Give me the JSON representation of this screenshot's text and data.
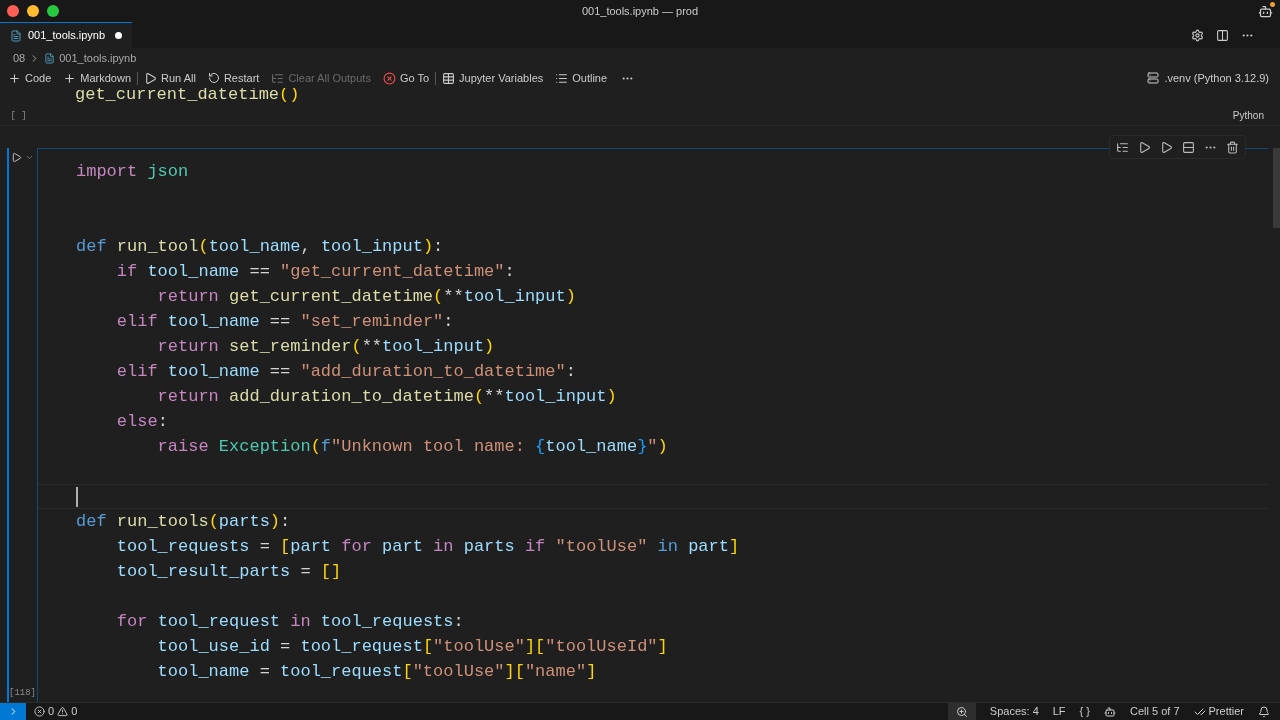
{
  "window": {
    "title": "001_tools.ipynb — prod"
  },
  "tabs": [
    {
      "label": "001_tools.ipynb",
      "selected": true,
      "modified": true
    }
  ],
  "breadcrumb": [
    "08",
    "001_tools.ipynb"
  ],
  "toolbar": {
    "groups": [
      [
        {
          "label": "Code",
          "kind": "add",
          "disabled": false
        },
        {
          "label": "Markdown",
          "kind": "add",
          "disabled": false
        }
      ],
      [
        {
          "label": "Run All",
          "kind": "run",
          "disabled": false
        },
        {
          "label": "Restart",
          "kind": "restart",
          "disabled": false
        },
        {
          "label": "Clear All Outputs",
          "kind": "clear",
          "disabled": true
        },
        {
          "label": "Go To",
          "kind": "goto",
          "disabled": false
        }
      ],
      [
        {
          "label": "Jupyter Variables",
          "kind": "variables",
          "disabled": false
        },
        {
          "label": "Outline",
          "kind": "outline",
          "disabled": false
        }
      ]
    ],
    "kernel": ".venv (Python 3.12.9)"
  },
  "previous_cell": {
    "lines": [
      {
        "kind": "code",
        "tokens": [
          {
            "kind": "fn",
            "text": "get_current_datetime"
          },
          {
            "kind": "br",
            "text": "()"
          }
        ]
      }
    ],
    "execution_count": "[ ]",
    "language": "Python"
  },
  "cell": {
    "focused": true,
    "execution_count": "[118]",
    "lines": [
      {
        "kind": "code",
        "tokens": [
          {
            "kind": "kw",
            "text": "import "
          },
          {
            "kind": "ty",
            "text": "json"
          }
        ]
      },
      {
        "kind": "blank"
      },
      {
        "kind": "blank"
      },
      {
        "kind": "code",
        "tokens": [
          {
            "kind": "def",
            "text": "def "
          },
          {
            "kind": "fn",
            "text": "run_tool"
          },
          {
            "kind": "br",
            "text": "("
          },
          {
            "kind": "var",
            "text": "tool_name"
          },
          {
            "kind": "p",
            "text": ", "
          },
          {
            "kind": "var",
            "text": "tool_input"
          },
          {
            "kind": "br",
            "text": ")"
          },
          {
            "kind": "p",
            "text": ":"
          }
        ]
      },
      {
        "kind": "code",
        "tokens": [
          {
            "kind": "kw",
            "text": "    if "
          },
          {
            "kind": "var",
            "text": "tool_name"
          },
          {
            "kind": "p",
            "text": " == "
          },
          {
            "kind": "str",
            "text": "\"get_current_datetime\""
          },
          {
            "kind": "p",
            "text": ":"
          }
        ]
      },
      {
        "kind": "code",
        "tokens": [
          {
            "kind": "kw",
            "text": "        return "
          },
          {
            "kind": "fn",
            "text": "get_current_datetime"
          },
          {
            "kind": "br",
            "text": "("
          },
          {
            "kind": "p",
            "text": "**"
          },
          {
            "kind": "var",
            "text": "tool_input"
          },
          {
            "kind": "br",
            "text": ")"
          }
        ]
      },
      {
        "kind": "code",
        "tokens": [
          {
            "kind": "kw",
            "text": "    elif "
          },
          {
            "kind": "var",
            "text": "tool_name"
          },
          {
            "kind": "p",
            "text": " == "
          },
          {
            "kind": "str",
            "text": "\"set_reminder\""
          },
          {
            "kind": "p",
            "text": ":"
          }
        ]
      },
      {
        "kind": "code",
        "tokens": [
          {
            "kind": "kw",
            "text": "        return "
          },
          {
            "kind": "fn",
            "text": "set_reminder"
          },
          {
            "kind": "br",
            "text": "("
          },
          {
            "kind": "p",
            "text": "**"
          },
          {
            "kind": "var",
            "text": "tool_input"
          },
          {
            "kind": "br",
            "text": ")"
          }
        ]
      },
      {
        "kind": "code",
        "tokens": [
          {
            "kind": "kw",
            "text": "    elif "
          },
          {
            "kind": "var",
            "text": "tool_name"
          },
          {
            "kind": "p",
            "text": " == "
          },
          {
            "kind": "str",
            "text": "\"add_duration_to_datetime\""
          },
          {
            "kind": "p",
            "text": ":"
          }
        ]
      },
      {
        "kind": "code",
        "tokens": [
          {
            "kind": "kw",
            "text": "        return "
          },
          {
            "kind": "fn",
            "text": "add_duration_to_datetime"
          },
          {
            "kind": "br",
            "text": "("
          },
          {
            "kind": "p",
            "text": "**"
          },
          {
            "kind": "var",
            "text": "tool_input"
          },
          {
            "kind": "br",
            "text": ")"
          }
        ]
      },
      {
        "kind": "code",
        "tokens": [
          {
            "kind": "kw",
            "text": "    else"
          },
          {
            "kind": "p",
            "text": ":"
          }
        ]
      },
      {
        "kind": "code",
        "tokens": [
          {
            "kind": "kw",
            "text": "        raise "
          },
          {
            "kind": "ty",
            "text": "Exception"
          },
          {
            "kind": "br",
            "text": "("
          },
          {
            "kind": "def",
            "text": "f"
          },
          {
            "kind": "str",
            "text": "\"Unknown tool name: "
          },
          {
            "kind": "cb",
            "text": "{"
          },
          {
            "kind": "var",
            "text": "tool_name"
          },
          {
            "kind": "cb",
            "text": "}"
          },
          {
            "kind": "str",
            "text": "\""
          },
          {
            "kind": "br",
            "text": ")"
          }
        ]
      },
      {
        "kind": "blank"
      },
      {
        "kind": "cursor"
      },
      {
        "kind": "code",
        "tokens": [
          {
            "kind": "def",
            "text": "def "
          },
          {
            "kind": "fn",
            "text": "run_tools"
          },
          {
            "kind": "br",
            "text": "("
          },
          {
            "kind": "var",
            "text": "parts"
          },
          {
            "kind": "br",
            "text": ")"
          },
          {
            "kind": "p",
            "text": ":"
          }
        ]
      },
      {
        "kind": "code",
        "tokens": [
          {
            "kind": "var",
            "text": "    tool_requests"
          },
          {
            "kind": "p",
            "text": " = "
          },
          {
            "kind": "br",
            "text": "["
          },
          {
            "kind": "var",
            "text": "part "
          },
          {
            "kind": "kw",
            "text": "for "
          },
          {
            "kind": "var",
            "text": "part "
          },
          {
            "kind": "kw",
            "text": "in "
          },
          {
            "kind": "var",
            "text": "parts "
          },
          {
            "kind": "kw",
            "text": "if "
          },
          {
            "kind": "str",
            "text": "\"toolUse\" "
          },
          {
            "kind": "def",
            "text": "in "
          },
          {
            "kind": "var",
            "text": "part"
          },
          {
            "kind": "br",
            "text": "]"
          }
        ]
      },
      {
        "kind": "code",
        "tokens": [
          {
            "kind": "var",
            "text": "    tool_result_parts"
          },
          {
            "kind": "p",
            "text": " = "
          },
          {
            "kind": "br",
            "text": "[]"
          }
        ]
      },
      {
        "kind": "blank"
      },
      {
        "kind": "code",
        "tokens": [
          {
            "kind": "kw",
            "text": "    for "
          },
          {
            "kind": "var",
            "text": "tool_request "
          },
          {
            "kind": "kw",
            "text": "in "
          },
          {
            "kind": "var",
            "text": "tool_requests"
          },
          {
            "kind": "p",
            "text": ":"
          }
        ]
      },
      {
        "kind": "code",
        "tokens": [
          {
            "kind": "var",
            "text": "        tool_use_id"
          },
          {
            "kind": "p",
            "text": " = "
          },
          {
            "kind": "var",
            "text": "tool_request"
          },
          {
            "kind": "br",
            "text": "["
          },
          {
            "kind": "str",
            "text": "\"toolUse\""
          },
          {
            "kind": "br",
            "text": "]["
          },
          {
            "kind": "str",
            "text": "\"toolUseId\""
          },
          {
            "kind": "br",
            "text": "]"
          }
        ]
      },
      {
        "kind": "code",
        "tokens": [
          {
            "kind": "var",
            "text": "        tool_name"
          },
          {
            "kind": "p",
            "text": " = "
          },
          {
            "kind": "var",
            "text": "tool_request"
          },
          {
            "kind": "br",
            "text": "["
          },
          {
            "kind": "str",
            "text": "\"toolUse\""
          },
          {
            "kind": "br",
            "text": "]["
          },
          {
            "kind": "str",
            "text": "\"name\""
          },
          {
            "kind": "br",
            "text": "]"
          }
        ]
      }
    ]
  },
  "status_bar": {
    "errors": "0",
    "warnings": "0",
    "indentation": "Spaces: 4",
    "eol": "LF",
    "braces": "{ }",
    "cell_position": "Cell 5 of 7",
    "formatter": "Prettier"
  }
}
